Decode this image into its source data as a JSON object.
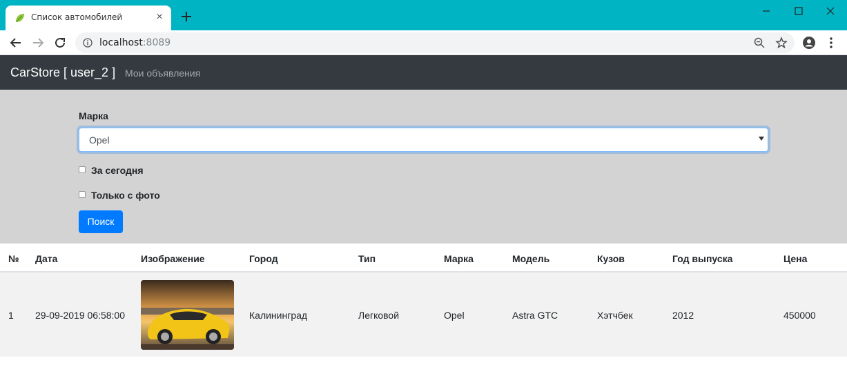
{
  "browser": {
    "tab_title": "Список автомобилей",
    "url_host": "localhost",
    "url_port": ":8089"
  },
  "navbar": {
    "brand": "CarStore [ user_2 ]",
    "link": "Мои объявления"
  },
  "filter": {
    "brand_label": "Марка",
    "brand_value": "Opel",
    "today_label": "За сегодня",
    "photo_label": "Только с фото",
    "search_button": "Поиск"
  },
  "table": {
    "headers": [
      "№",
      "Дата",
      "Изображение",
      "Город",
      "Тип",
      "Марка",
      "Модель",
      "Кузов",
      "Год выпуска",
      "Цена"
    ],
    "rows": [
      {
        "num": "1",
        "date": "29-09-2019 06:58:00",
        "city": "Калининград",
        "type": "Легковой",
        "brand": "Opel",
        "model": "Astra GTC",
        "body": "Хэтчбек",
        "year": "2012",
        "price": "450000"
      }
    ]
  },
  "colors": {
    "chrome": "#00b4c4",
    "navbar": "#343a40",
    "filter_bg": "#d3d3d3",
    "primary": "#007bff",
    "row_bg": "#f2f2f2"
  }
}
